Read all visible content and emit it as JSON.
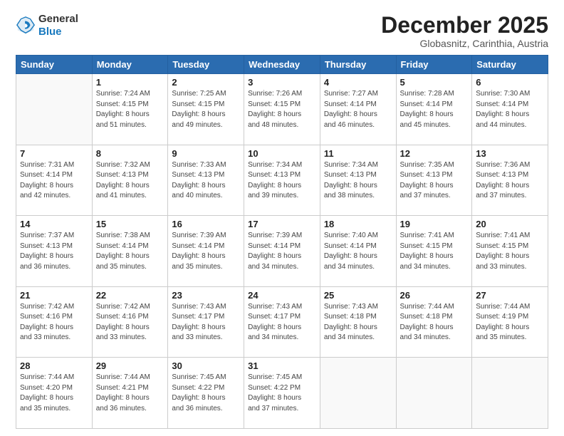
{
  "logo": {
    "general": "General",
    "blue": "Blue"
  },
  "header": {
    "month": "December 2025",
    "location": "Globasnitz, Carinthia, Austria"
  },
  "weekdays": [
    "Sunday",
    "Monday",
    "Tuesday",
    "Wednesday",
    "Thursday",
    "Friday",
    "Saturday"
  ],
  "weeks": [
    [
      {
        "day": "",
        "info": ""
      },
      {
        "day": "1",
        "info": "Sunrise: 7:24 AM\nSunset: 4:15 PM\nDaylight: 8 hours\nand 51 minutes."
      },
      {
        "day": "2",
        "info": "Sunrise: 7:25 AM\nSunset: 4:15 PM\nDaylight: 8 hours\nand 49 minutes."
      },
      {
        "day": "3",
        "info": "Sunrise: 7:26 AM\nSunset: 4:15 PM\nDaylight: 8 hours\nand 48 minutes."
      },
      {
        "day": "4",
        "info": "Sunrise: 7:27 AM\nSunset: 4:14 PM\nDaylight: 8 hours\nand 46 minutes."
      },
      {
        "day": "5",
        "info": "Sunrise: 7:28 AM\nSunset: 4:14 PM\nDaylight: 8 hours\nand 45 minutes."
      },
      {
        "day": "6",
        "info": "Sunrise: 7:30 AM\nSunset: 4:14 PM\nDaylight: 8 hours\nand 44 minutes."
      }
    ],
    [
      {
        "day": "7",
        "info": "Sunrise: 7:31 AM\nSunset: 4:14 PM\nDaylight: 8 hours\nand 42 minutes."
      },
      {
        "day": "8",
        "info": "Sunrise: 7:32 AM\nSunset: 4:13 PM\nDaylight: 8 hours\nand 41 minutes."
      },
      {
        "day": "9",
        "info": "Sunrise: 7:33 AM\nSunset: 4:13 PM\nDaylight: 8 hours\nand 40 minutes."
      },
      {
        "day": "10",
        "info": "Sunrise: 7:34 AM\nSunset: 4:13 PM\nDaylight: 8 hours\nand 39 minutes."
      },
      {
        "day": "11",
        "info": "Sunrise: 7:34 AM\nSunset: 4:13 PM\nDaylight: 8 hours\nand 38 minutes."
      },
      {
        "day": "12",
        "info": "Sunrise: 7:35 AM\nSunset: 4:13 PM\nDaylight: 8 hours\nand 37 minutes."
      },
      {
        "day": "13",
        "info": "Sunrise: 7:36 AM\nSunset: 4:13 PM\nDaylight: 8 hours\nand 37 minutes."
      }
    ],
    [
      {
        "day": "14",
        "info": "Sunrise: 7:37 AM\nSunset: 4:13 PM\nDaylight: 8 hours\nand 36 minutes."
      },
      {
        "day": "15",
        "info": "Sunrise: 7:38 AM\nSunset: 4:14 PM\nDaylight: 8 hours\nand 35 minutes."
      },
      {
        "day": "16",
        "info": "Sunrise: 7:39 AM\nSunset: 4:14 PM\nDaylight: 8 hours\nand 35 minutes."
      },
      {
        "day": "17",
        "info": "Sunrise: 7:39 AM\nSunset: 4:14 PM\nDaylight: 8 hours\nand 34 minutes."
      },
      {
        "day": "18",
        "info": "Sunrise: 7:40 AM\nSunset: 4:14 PM\nDaylight: 8 hours\nand 34 minutes."
      },
      {
        "day": "19",
        "info": "Sunrise: 7:41 AM\nSunset: 4:15 PM\nDaylight: 8 hours\nand 34 minutes."
      },
      {
        "day": "20",
        "info": "Sunrise: 7:41 AM\nSunset: 4:15 PM\nDaylight: 8 hours\nand 33 minutes."
      }
    ],
    [
      {
        "day": "21",
        "info": "Sunrise: 7:42 AM\nSunset: 4:16 PM\nDaylight: 8 hours\nand 33 minutes."
      },
      {
        "day": "22",
        "info": "Sunrise: 7:42 AM\nSunset: 4:16 PM\nDaylight: 8 hours\nand 33 minutes."
      },
      {
        "day": "23",
        "info": "Sunrise: 7:43 AM\nSunset: 4:17 PM\nDaylight: 8 hours\nand 33 minutes."
      },
      {
        "day": "24",
        "info": "Sunrise: 7:43 AM\nSunset: 4:17 PM\nDaylight: 8 hours\nand 34 minutes."
      },
      {
        "day": "25",
        "info": "Sunrise: 7:43 AM\nSunset: 4:18 PM\nDaylight: 8 hours\nand 34 minutes."
      },
      {
        "day": "26",
        "info": "Sunrise: 7:44 AM\nSunset: 4:18 PM\nDaylight: 8 hours\nand 34 minutes."
      },
      {
        "day": "27",
        "info": "Sunrise: 7:44 AM\nSunset: 4:19 PM\nDaylight: 8 hours\nand 35 minutes."
      }
    ],
    [
      {
        "day": "28",
        "info": "Sunrise: 7:44 AM\nSunset: 4:20 PM\nDaylight: 8 hours\nand 35 minutes."
      },
      {
        "day": "29",
        "info": "Sunrise: 7:44 AM\nSunset: 4:21 PM\nDaylight: 8 hours\nand 36 minutes."
      },
      {
        "day": "30",
        "info": "Sunrise: 7:45 AM\nSunset: 4:22 PM\nDaylight: 8 hours\nand 36 minutes."
      },
      {
        "day": "31",
        "info": "Sunrise: 7:45 AM\nSunset: 4:22 PM\nDaylight: 8 hours\nand 37 minutes."
      },
      {
        "day": "",
        "info": ""
      },
      {
        "day": "",
        "info": ""
      },
      {
        "day": "",
        "info": ""
      }
    ]
  ]
}
